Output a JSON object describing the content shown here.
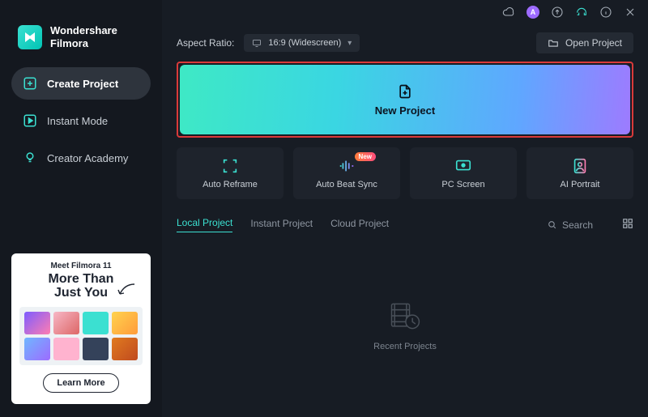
{
  "brand": {
    "line1": "Wondershare",
    "line2": "Filmora"
  },
  "sidebar": {
    "items": [
      {
        "label": "Create Project"
      },
      {
        "label": "Instant Mode"
      },
      {
        "label": "Creator Academy"
      }
    ]
  },
  "promo": {
    "kicker": "Meet Filmora 11",
    "title_line1": "More Than",
    "title_line2": "Just You",
    "cta": "Learn More"
  },
  "titlebar": {
    "avatar_initial": "A"
  },
  "toprow": {
    "aspect_label": "Aspect Ratio:",
    "aspect_value": "16:9 (Widescreen)",
    "open_project": "Open Project"
  },
  "new_project": {
    "label": "New Project"
  },
  "cards": [
    {
      "label": "Auto Reframe",
      "badge": null
    },
    {
      "label": "Auto Beat Sync",
      "badge": "New"
    },
    {
      "label": "PC Screen",
      "badge": null
    },
    {
      "label": "AI Portrait",
      "badge": null
    }
  ],
  "tabs": {
    "items": [
      "Local Project",
      "Instant Project",
      "Cloud Project"
    ],
    "active_index": 0,
    "search_placeholder": "Search"
  },
  "recent": {
    "label": "Recent Projects"
  }
}
